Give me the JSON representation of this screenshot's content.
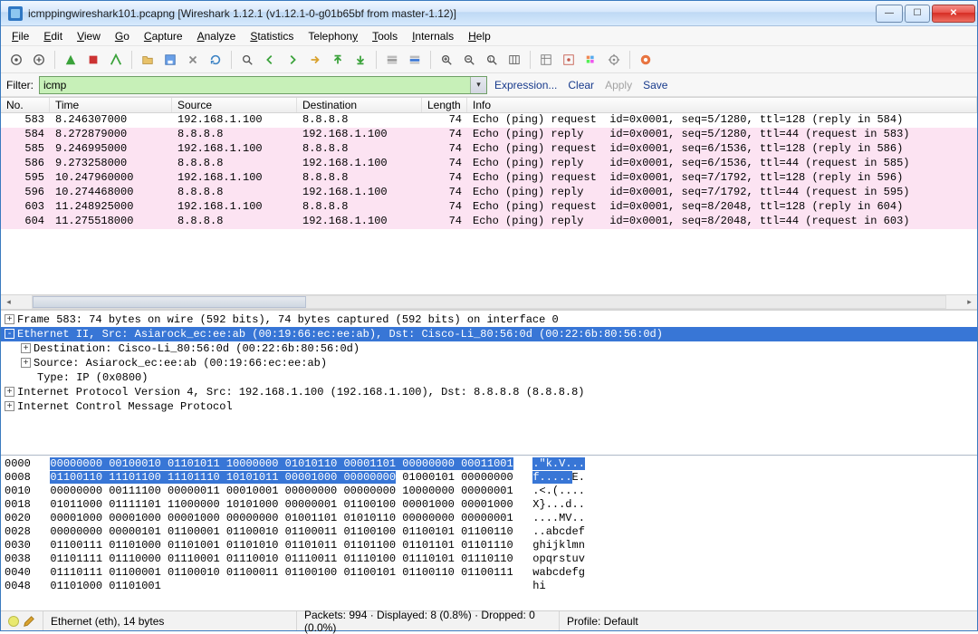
{
  "title": "icmppingwireshark101.pcapng    [Wireshark 1.12.1  (v1.12.1-0-g01b65bf from master-1.12)]",
  "menu": {
    "file": "File",
    "edit": "Edit",
    "view": "View",
    "go": "Go",
    "capture": "Capture",
    "analyze": "Analyze",
    "statistics": "Statistics",
    "telephony": "Telephony",
    "tools": "Tools",
    "internals": "Internals",
    "help": "Help"
  },
  "filter": {
    "label": "Filter:",
    "value": "icmp",
    "expression": "Expression...",
    "clear": "Clear",
    "apply": "Apply",
    "save": "Save"
  },
  "cols": {
    "no": "No.",
    "time": "Time",
    "src": "Source",
    "dst": "Destination",
    "len": "Length",
    "info": "Info"
  },
  "packets": [
    {
      "no": "583",
      "time": "8.246307000",
      "src": "192.168.1.100",
      "dst": "8.8.8.8",
      "len": "74",
      "info": "Echo (ping) request  id=0x0001, seq=5/1280, ttl=128 (reply in 584)",
      "cls": "first"
    },
    {
      "no": "584",
      "time": "8.272879000",
      "src": "8.8.8.8",
      "dst": "192.168.1.100",
      "len": "74",
      "info": "Echo (ping) reply    id=0x0001, seq=5/1280, ttl=44 (request in 583)",
      "cls": "rep"
    },
    {
      "no": "585",
      "time": "9.246995000",
      "src": "192.168.1.100",
      "dst": "8.8.8.8",
      "len": "74",
      "info": "Echo (ping) request  id=0x0001, seq=6/1536, ttl=128 (reply in 586)",
      "cls": "req"
    },
    {
      "no": "586",
      "time": "9.273258000",
      "src": "8.8.8.8",
      "dst": "192.168.1.100",
      "len": "74",
      "info": "Echo (ping) reply    id=0x0001, seq=6/1536, ttl=44 (request in 585)",
      "cls": "rep"
    },
    {
      "no": "595",
      "time": "10.247960000",
      "src": "192.168.1.100",
      "dst": "8.8.8.8",
      "len": "74",
      "info": "Echo (ping) request  id=0x0001, seq=7/1792, ttl=128 (reply in 596)",
      "cls": "req"
    },
    {
      "no": "596",
      "time": "10.274468000",
      "src": "8.8.8.8",
      "dst": "192.168.1.100",
      "len": "74",
      "info": "Echo (ping) reply    id=0x0001, seq=7/1792, ttl=44 (request in 595)",
      "cls": "rep"
    },
    {
      "no": "603",
      "time": "11.248925000",
      "src": "192.168.1.100",
      "dst": "8.8.8.8",
      "len": "74",
      "info": "Echo (ping) request  id=0x0001, seq=8/2048, ttl=128 (reply in 604)",
      "cls": "req"
    },
    {
      "no": "604",
      "time": "11.275518000",
      "src": "8.8.8.8",
      "dst": "192.168.1.100",
      "len": "74",
      "info": "Echo (ping) reply    id=0x0001, seq=8/2048, ttl=44 (request in 603)",
      "cls": "rep"
    }
  ],
  "tree": {
    "frame": "Frame 583: 74 bytes on wire (592 bits), 74 bytes captured (592 bits) on interface 0",
    "eth": "Ethernet II, Src: Asiarock_ec:ee:ab (00:19:66:ec:ee:ab), Dst: Cisco-Li_80:56:0d (00:22:6b:80:56:0d)",
    "eth_dst": "Destination: Cisco-Li_80:56:0d (00:22:6b:80:56:0d)",
    "eth_src": "Source: Asiarock_ec:ee:ab (00:19:66:ec:ee:ab)",
    "eth_type": "Type: IP (0x0800)",
    "ip": "Internet Protocol Version 4, Src: 192.168.1.100 (192.168.1.100), Dst: 8.8.8.8 (8.8.8.8)",
    "icmp": "Internet Control Message Protocol"
  },
  "hex_offsets": [
    "0000",
    "0008",
    "0010",
    "0018",
    "0020",
    "0028",
    "0030",
    "0038",
    "0040",
    "0048"
  ],
  "hex_bits_sel_a": "00000000 00100010 01101011 10000000 01010110 00001101 00000000 00011001",
  "hex_bits_sel_b": "01100110 11101100 11101110 10101011 00001000 00000000",
  "hex_bits_w1": " 01000101 00000000",
  "hex_rows_bits": [
    "00000000 00111100 00000011 00010001 00000000 00000000 10000000 00000001",
    "01011000 01111101 11000000 10101000 00000001 01100100 00001000 00001000",
    "00001000 00001000 00001000 00000000 01001101 01010110 00000000 00000001",
    "00000000 00000101 01100001 01100010 01100011 01100100 01100101 01100110",
    "01100111 01101000 01101001 01101010 01101011 01101100 01101101 01101110",
    "01101111 01110000 01110001 01110010 01110011 01110100 01110101 01110110",
    "01110111 01100001 01100010 01100011 01100100 01100101 01100110 01100111",
    "01101000 01101001"
  ],
  "hex_ascii_sel": ".\"k.V...",
  "hex_ascii_sel2": "f.....",
  "hex_ascii_w1": "E.",
  "hex_ascii": [
    ".<.(....",
    "X}...d..",
    "....MV..",
    "..abcdef",
    "ghijklmn",
    "opqrstuv",
    "wabcdefg",
    "hi"
  ],
  "status": {
    "eth": "Ethernet (eth), 14 bytes",
    "pkts": "Packets: 994 · Displayed: 8 (0.8%) · Dropped: 0 (0.0%)",
    "profile": "Profile: Default"
  }
}
